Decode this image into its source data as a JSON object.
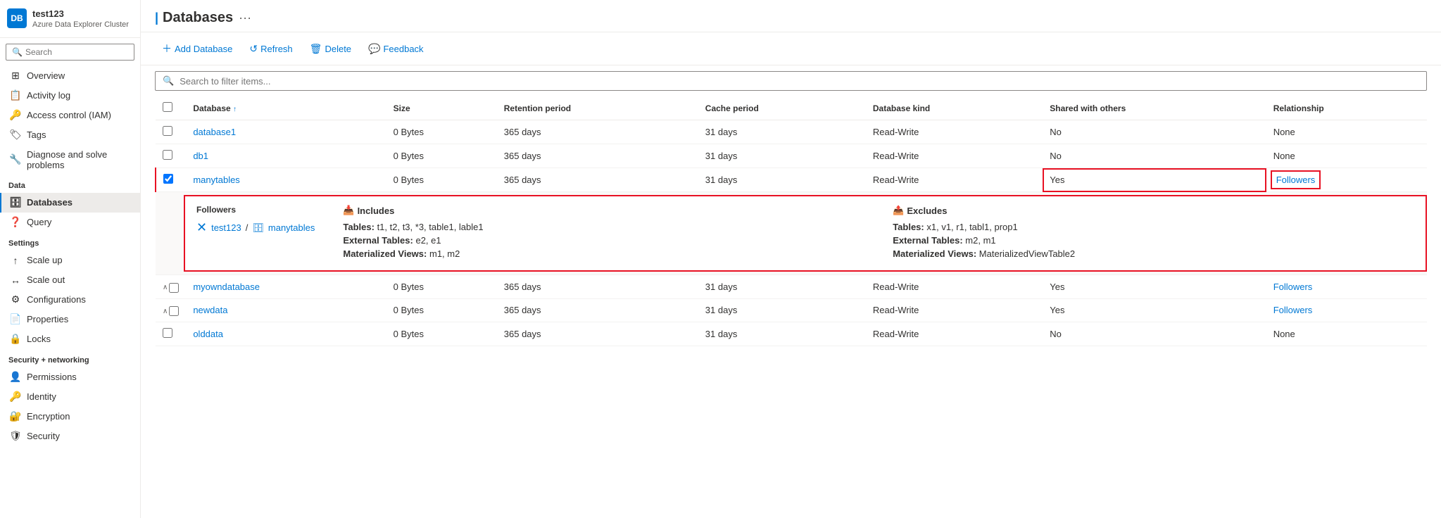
{
  "sidebar": {
    "logo_text": "DB",
    "cluster_name": "test123",
    "cluster_subtitle": "Azure Data Explorer Cluster",
    "search_placeholder": "Search",
    "collapse_icon": "«",
    "nav_items": [
      {
        "id": "overview",
        "label": "Overview",
        "icon": "⊞",
        "section": null
      },
      {
        "id": "activity-log",
        "label": "Activity log",
        "icon": "📋",
        "section": null
      },
      {
        "id": "access-control",
        "label": "Access control (IAM)",
        "icon": "🔑",
        "section": null
      },
      {
        "id": "tags",
        "label": "Tags",
        "icon": "🏷",
        "section": null
      },
      {
        "id": "diagnose",
        "label": "Diagnose and solve problems",
        "icon": "🔧",
        "section": null
      },
      {
        "id": "data-section",
        "label": "Data",
        "section_header": true
      },
      {
        "id": "databases",
        "label": "Databases",
        "icon": "🗄",
        "active": true,
        "section": "Data"
      },
      {
        "id": "query",
        "label": "Query",
        "icon": "❓",
        "section": "Data"
      },
      {
        "id": "settings-section",
        "label": "Settings",
        "section_header": true
      },
      {
        "id": "scale-up",
        "label": "Scale up",
        "icon": "↑",
        "section": "Settings"
      },
      {
        "id": "scale-out",
        "label": "Scale out",
        "icon": "↔",
        "section": "Settings"
      },
      {
        "id": "configurations",
        "label": "Configurations",
        "icon": "⚙",
        "section": "Settings"
      },
      {
        "id": "properties",
        "label": "Properties",
        "icon": "📄",
        "section": "Settings"
      },
      {
        "id": "locks",
        "label": "Locks",
        "icon": "🔒",
        "section": "Settings"
      },
      {
        "id": "security-section",
        "label": "Security + networking",
        "section_header": true
      },
      {
        "id": "permissions",
        "label": "Permissions",
        "icon": "👤",
        "section": "Security"
      },
      {
        "id": "identity",
        "label": "Identity",
        "icon": "🔑",
        "section": "Security"
      },
      {
        "id": "encryption",
        "label": "Encryption",
        "icon": "🔐",
        "section": "Security"
      },
      {
        "id": "security",
        "label": "Security",
        "icon": "🛡",
        "section": "Security"
      }
    ]
  },
  "header": {
    "title": "Databases",
    "dots_label": "···"
  },
  "toolbar": {
    "add_label": "Add Database",
    "refresh_label": "Refresh",
    "delete_label": "Delete",
    "feedback_label": "Feedback"
  },
  "search_filter": {
    "placeholder": "Search to filter items..."
  },
  "table": {
    "columns": [
      "Database ↑",
      "Size",
      "Retention period",
      "Cache period",
      "Database kind",
      "Shared with others",
      "Relationship"
    ],
    "rows": [
      {
        "id": "database1",
        "name": "database1",
        "size": "0 Bytes",
        "retention": "365 days",
        "cache": "31 days",
        "kind": "Read-Write",
        "shared": "No",
        "relationship": "None",
        "expanded": false,
        "link": true
      },
      {
        "id": "db1",
        "name": "db1",
        "size": "0 Bytes",
        "retention": "365 days",
        "cache": "31 days",
        "kind": "Read-Write",
        "shared": "No",
        "relationship": "None",
        "expanded": false,
        "link": true
      },
      {
        "id": "manytables",
        "name": "manytables",
        "size": "0 Bytes",
        "retention": "365 days",
        "cache": "31 days",
        "kind": "Read-Write",
        "shared": "Yes",
        "relationship": "Followers",
        "expanded": true,
        "link": true,
        "highlight_shared": true,
        "highlight_rel": true
      },
      {
        "id": "myowndatabase",
        "name": "myowndatabase",
        "size": "0 Bytes",
        "retention": "365 days",
        "cache": "31 days",
        "kind": "Read-Write",
        "shared": "Yes",
        "relationship": "Followers",
        "expanded": false,
        "has_expand": true,
        "link": true
      },
      {
        "id": "newdata",
        "name": "newdata",
        "size": "0 Bytes",
        "retention": "365 days",
        "cache": "31 days",
        "kind": "Read-Write",
        "shared": "Yes",
        "relationship": "Followers",
        "expanded": false,
        "has_expand": true,
        "link": true
      },
      {
        "id": "olddata",
        "name": "olddata",
        "size": "0 Bytes",
        "retention": "365 days",
        "cache": "31 days",
        "kind": "Read-Write",
        "shared": "No",
        "relationship": "None",
        "expanded": false,
        "link": true
      }
    ],
    "detail_panel": {
      "followers_label": "Followers",
      "follower_cluster": "test123",
      "follower_db": "manytables",
      "includes_label": "Includes",
      "includes_tables": "Tables: t1, t2, t3, *3, table1, lable1",
      "includes_ext_tables": "External Tables: e2, e1",
      "includes_mat_views": "Materialized Views: m1, m2",
      "excludes_label": "Excludes",
      "excludes_tables": "Tables: x1, v1, r1, tabl1, prop1",
      "excludes_ext_tables": "External Tables: m2, m1",
      "excludes_mat_views": "Materialized Views: MaterializedViewTable2"
    }
  }
}
